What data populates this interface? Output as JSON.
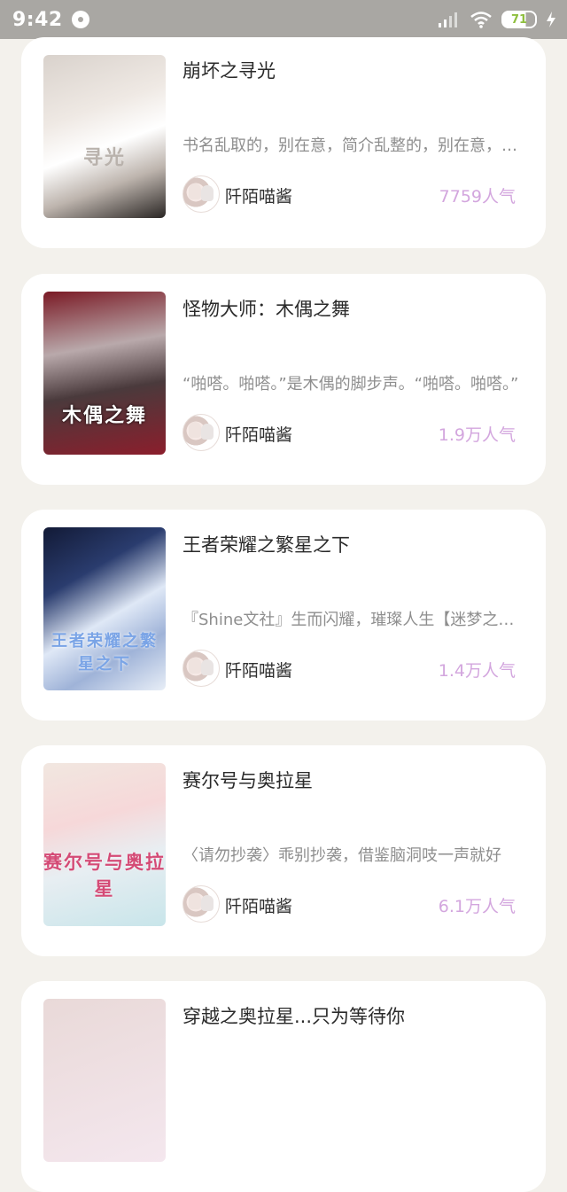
{
  "status_bar": {
    "time": "9:42",
    "battery": "71",
    "battery_level_percent": 71,
    "icons": [
      "message-bubble-icon",
      "signal-icon",
      "wifi-icon",
      "battery-icon",
      "charging-icon"
    ]
  },
  "books": [
    {
      "title": "崩坏之寻光",
      "description": "书名乱取的，别在意，简介乱整的，别在意，反正就是这样子的一个故事",
      "author": "阡陌喵酱",
      "popularity": "7759人气",
      "cover_text": "寻光"
    },
    {
      "title": "怪物大师：木偶之舞",
      "description": "“啪嗒。啪嗒。”是木偶的脚步声。“啪嗒。啪嗒。”",
      "author": "阡陌喵酱",
      "popularity": "1.9万人气",
      "cover_text": "木偶之舞"
    },
    {
      "title": "王者荣耀之繁星之下",
      "description": "『Shine文社』生而闪耀，璀璨人生【迷梦之城】",
      "author": "阡陌喵酱",
      "popularity": "1.4万人气",
      "cover_text": "王者荣耀之繁星之下"
    },
    {
      "title": "赛尔号与奥拉星",
      "description": "〈请勿抄袭〉乖别抄袭，借鉴脑洞吱一声就好",
      "author": "阡陌喵酱",
      "popularity": "6.1万人气",
      "cover_text": "赛尔号与奥拉星"
    }
  ],
  "partial_card": {
    "title": "穿越之奥拉星...只为等待你"
  },
  "colors": {
    "background": "#f3f1ec",
    "card": "#ffffff",
    "popularity": "#d3a6de",
    "status_bar": "#a9a7a3"
  }
}
